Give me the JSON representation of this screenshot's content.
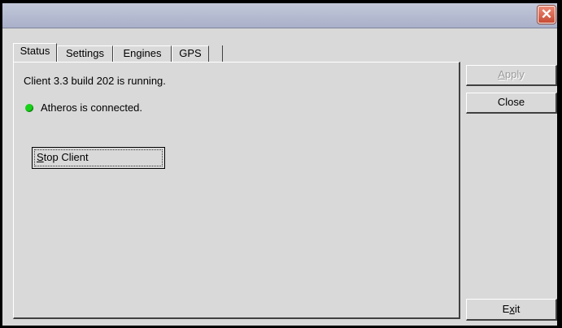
{
  "window": {
    "close_icon": "close-icon",
    "accent": "#e06a55"
  },
  "tabs": [
    {
      "label": "Status",
      "active": true
    },
    {
      "label": "Settings",
      "active": false
    },
    {
      "label": "Engines",
      "active": false
    },
    {
      "label": "GPS",
      "active": false
    }
  ],
  "status": {
    "client_text": "Client 3.3 build 202 is running.",
    "connection_text": "Atheros is connected.",
    "connection_color": "#18d21a",
    "stop_button": {
      "mnemonic": "S",
      "rest": "top Client"
    }
  },
  "side_buttons": {
    "apply": {
      "mnemonic": "A",
      "rest": "pply",
      "disabled": true
    },
    "close": {
      "label": "Close"
    },
    "exit": {
      "before": "E",
      "mnemonic": "x",
      "after": "it"
    }
  }
}
